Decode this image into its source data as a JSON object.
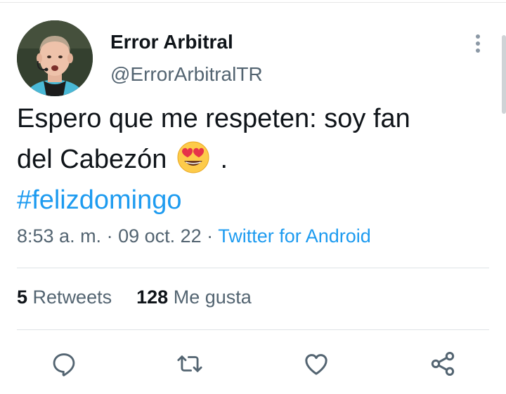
{
  "author": {
    "display_name": "Error Arbitral",
    "handle": "@ErrorArbitralTR"
  },
  "tweet": {
    "line1": "Espero que me respeten: soy fan",
    "line2_before_emoji": "del Cabezón",
    "emoji": "smiling-face-with-heart-eyes",
    "line2_after_emoji": ".",
    "hashtag": "#felizdomingo"
  },
  "meta": {
    "time": "8:53 a. m.",
    "separator1": " · ",
    "date": "09 oct. 22",
    "separator2": " · ",
    "source": "Twitter for Android"
  },
  "stats": {
    "retweets_count": "5",
    "retweets_label": "Retweets",
    "likes_count": "128",
    "likes_label": "Me gusta"
  },
  "actions": [
    "reply-icon",
    "retweet-icon",
    "like-icon",
    "share-icon"
  ],
  "colors": {
    "accent": "#1d9bf0",
    "text": "#0f1419",
    "secondary": "#536471",
    "icon": "#536471"
  }
}
